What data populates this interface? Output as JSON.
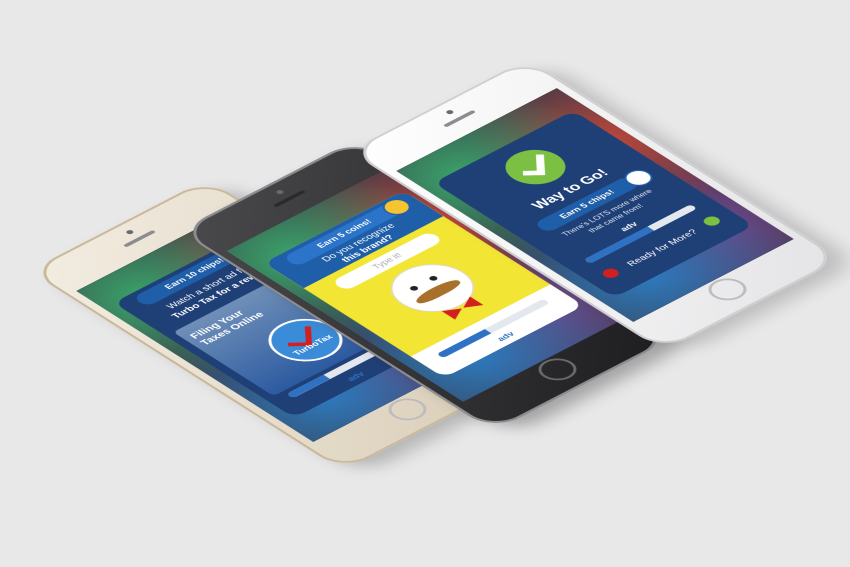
{
  "phones": {
    "left": {
      "chip_label": "Earn 10 chips!",
      "line1": "Watch a short ad from",
      "line2": "Turbo Tax for a reward!",
      "ad_title": "Filing Your Taxes Online",
      "brand_name": "TurboTax",
      "logo_text": "adv",
      "progress": 0.35
    },
    "center": {
      "coin_label": "Earn 5 coins!",
      "question_line1": "Do you recognize",
      "question_line2": "this brand?",
      "input_placeholder": "Type it!",
      "logo_text": "adv",
      "progress": 0.45
    },
    "right": {
      "title": "Way to Go!",
      "chip_label": "Earn 5 chips!",
      "subtext_line1": "There's LOTS more where",
      "subtext_line2": "that came from!",
      "ready_label": "Ready for More?",
      "logo_text": "adv",
      "progress": 0.6
    }
  },
  "colors": {
    "check_green": "#7bc043",
    "card_blue": "#1f3f77",
    "center_yellow": "#f2e534",
    "bowtie_red": "#d21f1f"
  }
}
